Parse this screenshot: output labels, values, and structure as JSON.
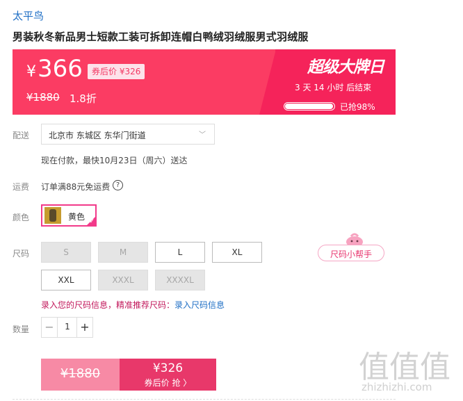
{
  "header": {
    "brand": "太平鸟",
    "title": "男装秋冬新品男士短款工装可拆卸连帽白鸭绒羽绒服男式羽绒服"
  },
  "price_banner": {
    "currency_symbol": "¥",
    "price": "366",
    "coupon_price": "券后价 ¥326",
    "original_price": "¥1880",
    "discount": "1.8折",
    "event_title": "超级大牌日",
    "countdown": "3 天 14 小时 后结束",
    "progress_fraction": 0.98,
    "progress_text": "已抢98%",
    "colors": {
      "banner": "#fb3c63",
      "banner_dark": "#f5235a"
    }
  },
  "delivery": {
    "label": "配送",
    "address": "北京市 东城区 东华门街道",
    "eta": "现在付款，最快10月23日（周六）送达"
  },
  "shipping": {
    "label": "运费",
    "text": "订单满88元免运费",
    "help_icon": "?"
  },
  "color": {
    "label": "颜色",
    "option": "黄色",
    "check_icon": "✓"
  },
  "size": {
    "label": "尺码",
    "options": [
      {
        "label": "S",
        "available": false
      },
      {
        "label": "M",
        "available": false
      },
      {
        "label": "L",
        "available": true
      },
      {
        "label": "XL",
        "available": true
      },
      {
        "label": "XXL",
        "available": true
      },
      {
        "label": "XXXL",
        "available": false
      },
      {
        "label": "XXXXL",
        "available": false
      }
    ],
    "helper": "尺码小帮手",
    "tip_prefix": "录入您的尺码信息，精准推荐尺码：",
    "tip_link": "录入尺码信息"
  },
  "quantity": {
    "label": "数量",
    "minus": "−",
    "value": "1",
    "plus": "+"
  },
  "buy": {
    "original_price": "¥1880",
    "coupon_price": "¥326",
    "action": "券后价 抢 〉"
  },
  "watermark": {
    "glyphs": "值值值",
    "text": "zhizhizhi.com"
  }
}
